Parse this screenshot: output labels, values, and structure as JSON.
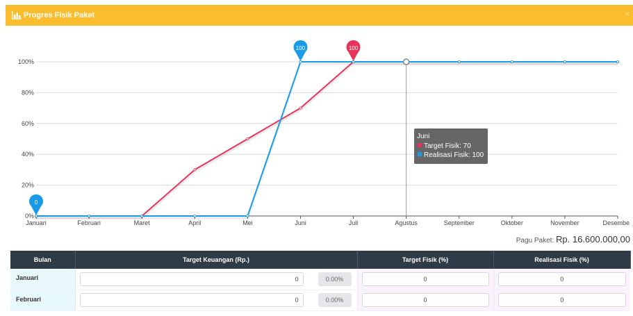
{
  "modal": {
    "title": "Progres Fisik Paket",
    "close": "×"
  },
  "colors": {
    "header": "#fbbd2e",
    "target": "#e8345a",
    "realisasi": "#1a9bea",
    "table_header": "#2f3b46"
  },
  "chart_data": {
    "type": "line",
    "categories": [
      "Januari",
      "Februari",
      "Maret",
      "April",
      "Mei",
      "Juni",
      "Juli",
      "Agustus",
      "September",
      "Oktober",
      "November",
      "Desember"
    ],
    "category_labels": [
      "Januari",
      "Februari",
      "Maret",
      "April",
      "Mei",
      "Juni",
      "Juli",
      "Agustus",
      "September",
      "Oktober",
      "November",
      "Desembe"
    ],
    "y_ticks": [
      "0%",
      "20%",
      "40%",
      "60%",
      "80%",
      "100%"
    ],
    "ylim": [
      0,
      100
    ],
    "grid": true,
    "series": [
      {
        "name": "Target Fisik",
        "color": "#e8345a",
        "values": [
          0,
          0,
          0,
          30,
          50,
          70,
          100,
          100,
          100,
          100,
          100,
          100
        ]
      },
      {
        "name": "Realisasi Fisik",
        "color": "#1a9bea",
        "values": [
          0,
          0,
          0,
          0,
          0,
          100,
          100,
          100,
          100,
          100,
          100,
          100
        ]
      }
    ],
    "markers": [
      {
        "series": 1,
        "index": 0,
        "label": "0"
      },
      {
        "series": 1,
        "index": 5,
        "label": "100"
      },
      {
        "series": 0,
        "index": 6,
        "label": "100"
      }
    ],
    "crosshair_index": 7,
    "tooltip": {
      "title": "Juni",
      "lines": [
        "Target Fisik: 70",
        "Realisasi Fisik: 100"
      ]
    }
  },
  "pagu": {
    "label": "Pagu Paket:",
    "value": "Rp. 16.600.000,00"
  },
  "table": {
    "headers": [
      "Bulan",
      "Target Keuangan (Rp.)",
      "Target Fisik (%)",
      "Realisasi Fisik (%)"
    ],
    "rows": [
      {
        "bulan": "Januari",
        "keuangan": "0",
        "persen": "0.00%",
        "target_fisik": "0",
        "realisasi_fisik": "0"
      },
      {
        "bulan": "Februari",
        "keuangan": "0",
        "persen": "0.00%",
        "target_fisik": "0",
        "realisasi_fisik": "0"
      }
    ]
  }
}
